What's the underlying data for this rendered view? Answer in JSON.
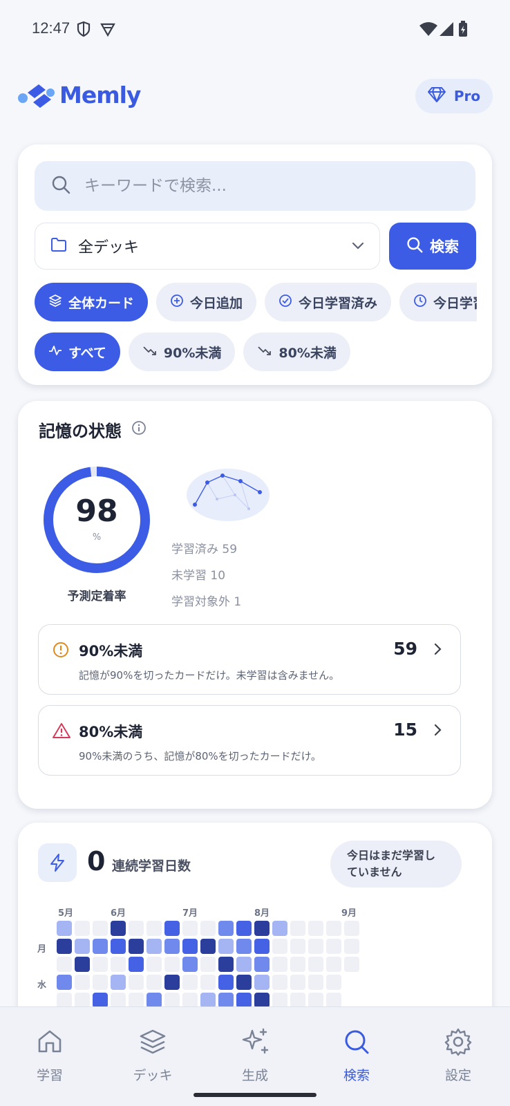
{
  "status": {
    "time": "12:47"
  },
  "app": {
    "name": "Memly",
    "pro_label": "Pro",
    "brand_color": "#3d5ce6"
  },
  "search": {
    "placeholder": "キーワードで検索...",
    "deck": "全デッキ",
    "button": "検索",
    "filters": [
      "全体カード",
      "今日追加",
      "今日学習済み",
      "今日学習"
    ],
    "thresholds": [
      "すべて",
      "90%未満",
      "80%未満"
    ]
  },
  "memory": {
    "title": "記憶の状態",
    "retention": 98,
    "retention_value": "98",
    "retention_unit": "%",
    "retention_label": "予測定着率",
    "stats": [
      "学習済み 59",
      "未学習 10",
      "学習対象外 1"
    ],
    "items": [
      {
        "title": "90%未満",
        "count": "59",
        "desc": "記憶が90%を切ったカードだけ。未学習は含みません。",
        "icon": "warning-circle-icon",
        "color": "#e08a1e"
      },
      {
        "title": "80%未満",
        "count": "15",
        "desc": "90%未満のうち、記憶が80%を切ったカードだけ。",
        "icon": "warning-triangle-icon",
        "color": "#d43a5a"
      }
    ]
  },
  "streak": {
    "count": "0",
    "label": "連続学習日数",
    "badge": "今日はまだ学習していません",
    "months": [
      "5月",
      "6月",
      "7月",
      "8月",
      "9月"
    ],
    "days": [
      "月",
      "水"
    ],
    "levels": [
      [
        1,
        0,
        0,
        4,
        0,
        0,
        3,
        0,
        0,
        2,
        3,
        4,
        1,
        0,
        0,
        0,
        0
      ],
      [
        4,
        1,
        2,
        3,
        4,
        1,
        2,
        3,
        4,
        1,
        2,
        3,
        0,
        0,
        0,
        0,
        0
      ],
      [
        0,
        4,
        0,
        0,
        3,
        0,
        0,
        2,
        0,
        4,
        1,
        2,
        0,
        0,
        0,
        0,
        0
      ],
      [
        2,
        0,
        0,
        1,
        0,
        0,
        4,
        0,
        0,
        3,
        4,
        1,
        0,
        0,
        0,
        0
      ],
      [
        0,
        0,
        3,
        0,
        0,
        2,
        0,
        0,
        1,
        2,
        3,
        4,
        0,
        0,
        0,
        0
      ]
    ]
  },
  "nav": {
    "items": [
      "学習",
      "デッキ",
      "生成",
      "検索",
      "設定"
    ],
    "active": "検索"
  }
}
